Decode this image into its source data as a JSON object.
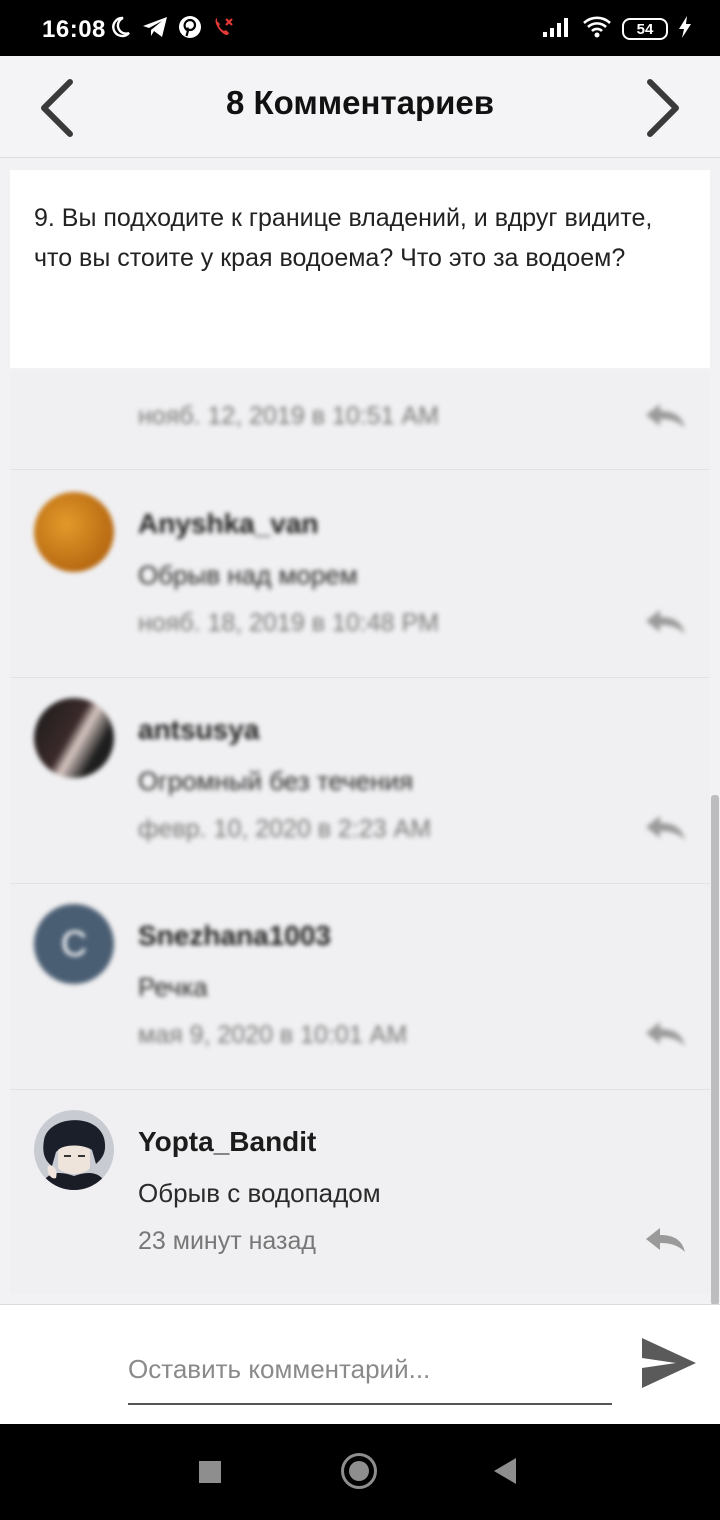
{
  "status_bar": {
    "time": "16:08",
    "battery": "54",
    "left_icons": [
      "moon-icon",
      "telegram-icon",
      "pinterest-icon",
      "missed-call-icon"
    ],
    "right_icons": [
      "signal-icon",
      "wifi-icon",
      "battery-icon",
      "charging-icon"
    ]
  },
  "header": {
    "title": "8 Комментариев"
  },
  "question": {
    "text": "9. Вы подходите к границе владений, и вдруг видите, что вы стоите у края водоема? Что это за водоем?"
  },
  "partial_comment": {
    "date": "нояб. 12, 2019 в 10:51 AM"
  },
  "comments": [
    {
      "author": "Anyshka_van",
      "text": "Обрыв над морем",
      "date": "нояб. 18, 2019 в 10:48 PM",
      "avatar": "photo",
      "blurred": true
    },
    {
      "author": "antsusya",
      "text": "Огромный без течения",
      "date": "февр. 10, 2020 в 2:23 AM",
      "avatar": "photo",
      "blurred": true
    },
    {
      "author": "Snezhana1003",
      "text": "Речка",
      "date": "мая 9, 2020 в 10:01 AM",
      "avatar": "C",
      "blurred": true
    },
    {
      "author": "Yopta_Bandit",
      "text": "Обрыв с водопадом",
      "date": "23 минут назад",
      "avatar": "photo",
      "blurred": false
    }
  ],
  "composer": {
    "placeholder": "Оставить комментарий..."
  },
  "colors": {
    "accent": "#555555",
    "background": "#f2f2f4",
    "avatar_letter_bg": "#4a5e73"
  }
}
